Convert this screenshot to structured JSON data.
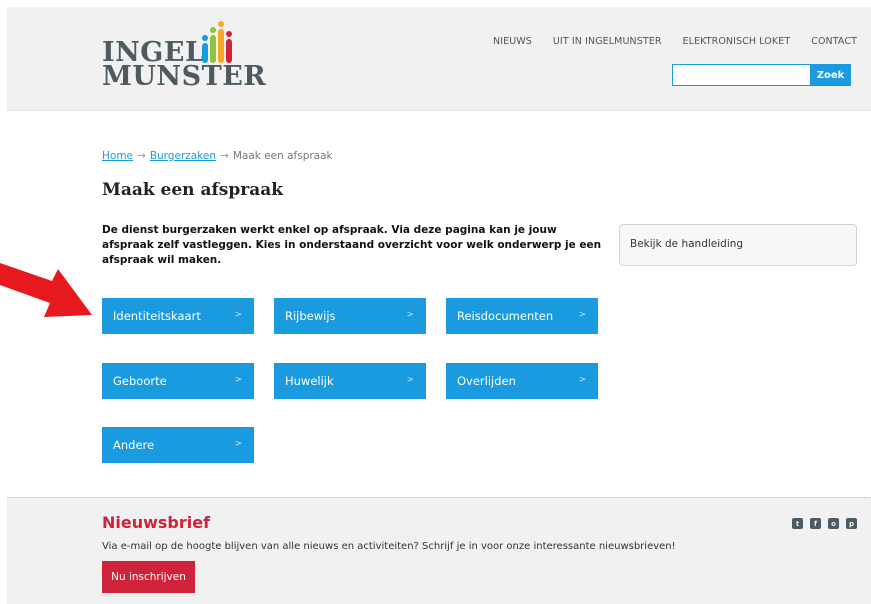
{
  "logo": {
    "line1": "INGEL",
    "line2": "MUNSTER"
  },
  "topnav": {
    "items": [
      "NIEUWS",
      "UIT IN INGELMUNSTER",
      "ELEKTRONISCH LOKET",
      "CONTACT"
    ]
  },
  "search": {
    "value": "",
    "placeholder": "",
    "button_label": "Zoek"
  },
  "breadcrumb": {
    "home": "Home",
    "sep1": "→",
    "level2": "Burgerzaken",
    "sep2": "→",
    "current": "Maak een afspraak"
  },
  "page": {
    "title": "Maak een afspraak",
    "intro": "De dienst burgerzaken werkt enkel op afspraak. Via deze pagina kan je jouw afspraak zelf vastleggen. Kies in onderstaand overzicht voor welk onderwerp je een afspraak wil maken.",
    "manual_link": "Bekijk de handleiding"
  },
  "tiles": [
    "Identiteitskaart",
    "Rijbewijs",
    "Reisdocumenten",
    "Geboorte",
    "Huwelijk",
    "Overlijden",
    "Andere"
  ],
  "tile_chevron": ">",
  "newsletter": {
    "title": "Nieuwsbrief",
    "text": "Via e-mail op de hoogte blijven van alle nieuws en activiteiten? Schrijf je in voor onze interessante nieuwsbrieven!",
    "button_label": "Nu inschrijven"
  },
  "social": {
    "icons": [
      "twitter-icon",
      "facebook-icon",
      "instagram-icon",
      "pinterest-icon"
    ],
    "glyphs": [
      "t",
      "f",
      "o",
      "p"
    ]
  },
  "colors": {
    "accent": "#1a9be0",
    "brand_red": "#d0223a",
    "logo_gray": "#4d5a61",
    "arrow_red": "#e8191c"
  }
}
